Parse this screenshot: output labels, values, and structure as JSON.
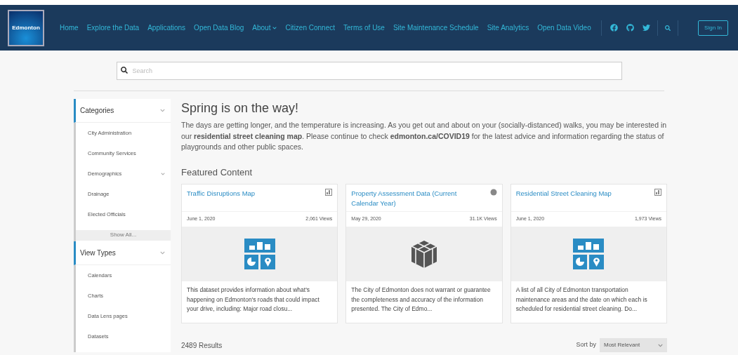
{
  "header": {
    "logo": "Edmonton",
    "nav": [
      {
        "label": "Home",
        "kind": "link"
      },
      {
        "label": "Explore the Data",
        "kind": "link"
      },
      {
        "label": "Applications",
        "kind": "link"
      },
      {
        "label": "Open Data Blog",
        "kind": "link"
      },
      {
        "label": "About",
        "kind": "dropdown"
      },
      {
        "label": "Citizen Connect",
        "kind": "link"
      },
      {
        "label": "Terms of Use",
        "kind": "link"
      },
      {
        "label": "Site Maintenance Schedule",
        "kind": "link"
      },
      {
        "label": "Site Analytics",
        "kind": "link"
      },
      {
        "label": "Open Data Video",
        "kind": "link"
      }
    ],
    "sign_in": "Sign In"
  },
  "search": {
    "placeholder": "Search"
  },
  "sidebar": [
    {
      "title": "Categories",
      "expanded": true,
      "items": [
        {
          "label": "City Administration",
          "has_children": false
        },
        {
          "label": "Community Services",
          "has_children": false
        },
        {
          "label": "Demographics",
          "has_children": true
        },
        {
          "label": "Drainage",
          "has_children": false
        },
        {
          "label": "Elected Officials",
          "has_children": false
        }
      ],
      "show_all": "Show All..."
    },
    {
      "title": "View Types",
      "expanded": true,
      "items": [
        {
          "label": "Calendars",
          "has_children": false
        },
        {
          "label": "Charts",
          "has_children": false
        },
        {
          "label": "Data Lens pages",
          "has_children": false
        },
        {
          "label": "Datasets",
          "has_children": false
        }
      ]
    }
  ],
  "announcement": {
    "title": "Spring is on the way!",
    "text": "The days are getting longer, and the temperature is increasing. As you get out and about on your (socially-distanced) walks, you may be interested in our **residential street cleaning map**. Please continue to check **edmonton.ca/COVID19** for the latest advice and information regarding the status of playgrounds and other public spaces."
  },
  "featured": {
    "title": "Featured Content",
    "cards": [
      {
        "kind": "map",
        "title": "Traffic Disruptions Map",
        "date": "June 1, 2020",
        "views": "2,061 Views",
        "description": "This dataset provides information about what's happening on Edmonton's roads that could impact your drive, including: Major road closu..."
      },
      {
        "kind": "dataset",
        "title": "Property Assessment Data (Current Calendar Year)",
        "date": "May 29, 2020",
        "views": "31.1K Views",
        "description": "The City of Edmonton does not warrant or guarantee the completeness and accuracy of the information presented. The City of Edmo..."
      },
      {
        "kind": "map",
        "title": "Residential Street Cleaning Map",
        "date": "June 1, 2020",
        "views": "1,973 Views",
        "description": "A list of all City of Edmonton transportation maintenance areas and the date on which each is scheduled for residential street cleaning. Do..."
      }
    ]
  },
  "results": {
    "count": "2489 Results",
    "sort_label": "Sort by",
    "sort_value": "Most Relevant"
  }
}
